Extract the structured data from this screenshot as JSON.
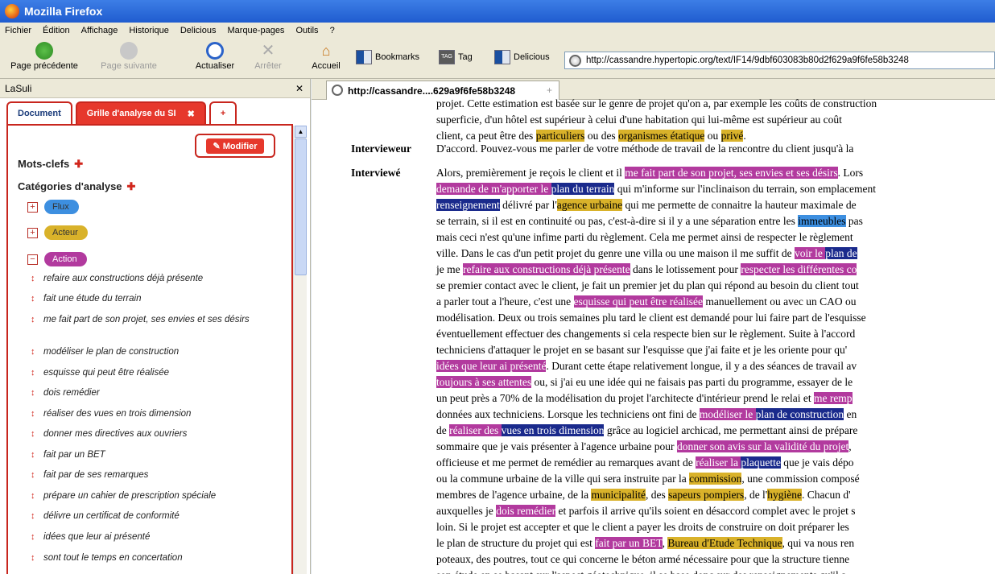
{
  "window": {
    "title": "Mozilla Firefox"
  },
  "menu": [
    "Fichier",
    "Édition",
    "Affichage",
    "Historique",
    "Delicious",
    "Marque-pages",
    "Outils",
    "?"
  ],
  "nav": {
    "back": "Page précédente",
    "forward": "Page suivante",
    "reload": "Actualiser",
    "stop": "Arrêter",
    "home": "Accueil"
  },
  "bookmarks": {
    "bookmarks": "Bookmarks",
    "tag": "Tag",
    "delicious": "Delicious"
  },
  "url": "http://cassandre.hypertopic.org/text/IF14/9dbf603083b80d2f629a9f6fe58b3248",
  "sidebar": {
    "title": "LaSuli",
    "tabs": {
      "document": "Document",
      "grille": "Grille d'analyse du SI",
      "add": "+"
    },
    "modifier": "Modifier",
    "keywords": "Mots-clefs",
    "categories": "Catégories d'analyse",
    "cats": [
      {
        "label": "Flux",
        "color": "#3d8fe0"
      },
      {
        "label": "Acteur",
        "color": "#d9b22a"
      },
      {
        "label": "Action",
        "color": "#b23a9e"
      }
    ],
    "items": [
      "refaire aux constructions déjà présente",
      "fait une étude du terrain",
      "me fait part de son projet, ses envies et ses désirs",
      "modéliser le plan de construction",
      "esquisse qui peut être réalisée",
      "dois remédier",
      "réaliser des vues en trois dimension",
      "donner mes directives aux ouvriers",
      "fait par un BET",
      "fait par de ses remarques",
      "prépare un cahier de prescription spéciale",
      "délivre un certificat de conformité",
      "idées que leur ai présenté",
      "sont tout le temps en concertation"
    ]
  },
  "content": {
    "tab_title": "http://cassandre....629a9f6fe58b3248",
    "speakers": {
      "a": "Intervieweur",
      "b": "Interviewé"
    }
  }
}
